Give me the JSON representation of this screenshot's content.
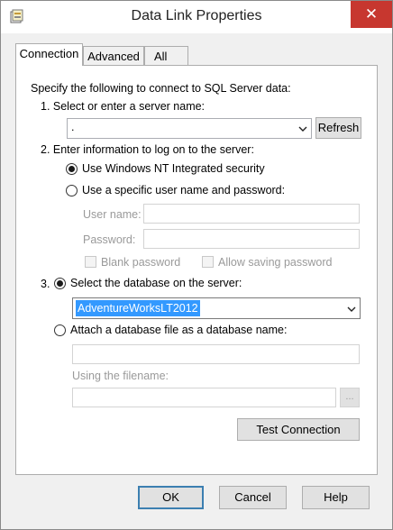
{
  "window": {
    "title": "Data Link Properties",
    "close_symbol": "✕"
  },
  "tabs": [
    {
      "label": "Connection",
      "active": true
    },
    {
      "label": "Advanced",
      "active": false
    },
    {
      "label": "All",
      "active": false
    }
  ],
  "connection": {
    "intro": "Specify the following to connect to SQL Server data:",
    "step1": "1. Select or enter a server name:",
    "server_value": ".",
    "refresh_label": "Refresh",
    "step2": "2. Enter information to log on to the server:",
    "radio_windows": "Use Windows NT Integrated security",
    "radio_specific": "Use a specific user name and password:",
    "username_label": "User name:",
    "password_label": "Password:",
    "blank_password": "Blank password",
    "allow_saving": "Allow saving password",
    "step3_number": "3.",
    "radio_select_db": "Select the database on the server:",
    "database_value": "AdventureWorksLT2012",
    "radio_attach": "Attach a database file as a database name:",
    "using_filename": "Using the filename:",
    "browse_label": "...",
    "test_connection": "Test Connection"
  },
  "footer": {
    "ok": "OK",
    "cancel": "Cancel",
    "help": "Help"
  },
  "colors": {
    "selection": "#3399ff",
    "close_red": "#c7372f"
  }
}
